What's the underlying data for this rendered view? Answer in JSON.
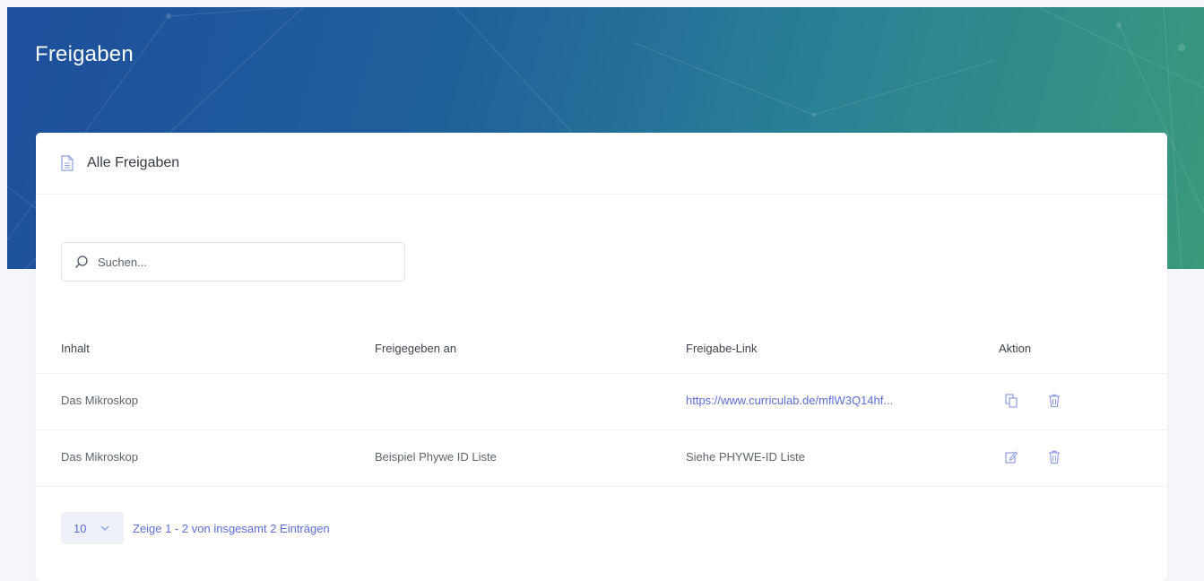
{
  "page": {
    "title": "Freigaben"
  },
  "card": {
    "title": "Alle Freigaben",
    "icon": "document-icon"
  },
  "search": {
    "placeholder": "Suchen...",
    "value": "",
    "icon": "search-icon"
  },
  "table": {
    "columns": [
      "Inhalt",
      "Freigegeben an",
      "Freigabe-Link",
      "Aktion"
    ],
    "rows": [
      {
        "inhalt": "Das Mikroskop",
        "freigegeben_an": "",
        "link": "https://www.curriculab.de/mflW3Q14hf...",
        "actions": [
          "copy-icon",
          "trash-icon"
        ]
      },
      {
        "inhalt": "Das Mikroskop",
        "freigegeben_an": "Beispiel Phywe ID Liste",
        "link": "Siehe PHYWE-ID Liste",
        "actions": [
          "edit-icon",
          "trash-icon"
        ]
      }
    ]
  },
  "pagination": {
    "page_size": "10",
    "info": "Zeige 1 - 2 von insgesamt 2 Einträgen"
  },
  "colors": {
    "accent": "#5b6fd6",
    "hero_start": "#1d4f9c",
    "hero_end": "#3a9a7c"
  }
}
